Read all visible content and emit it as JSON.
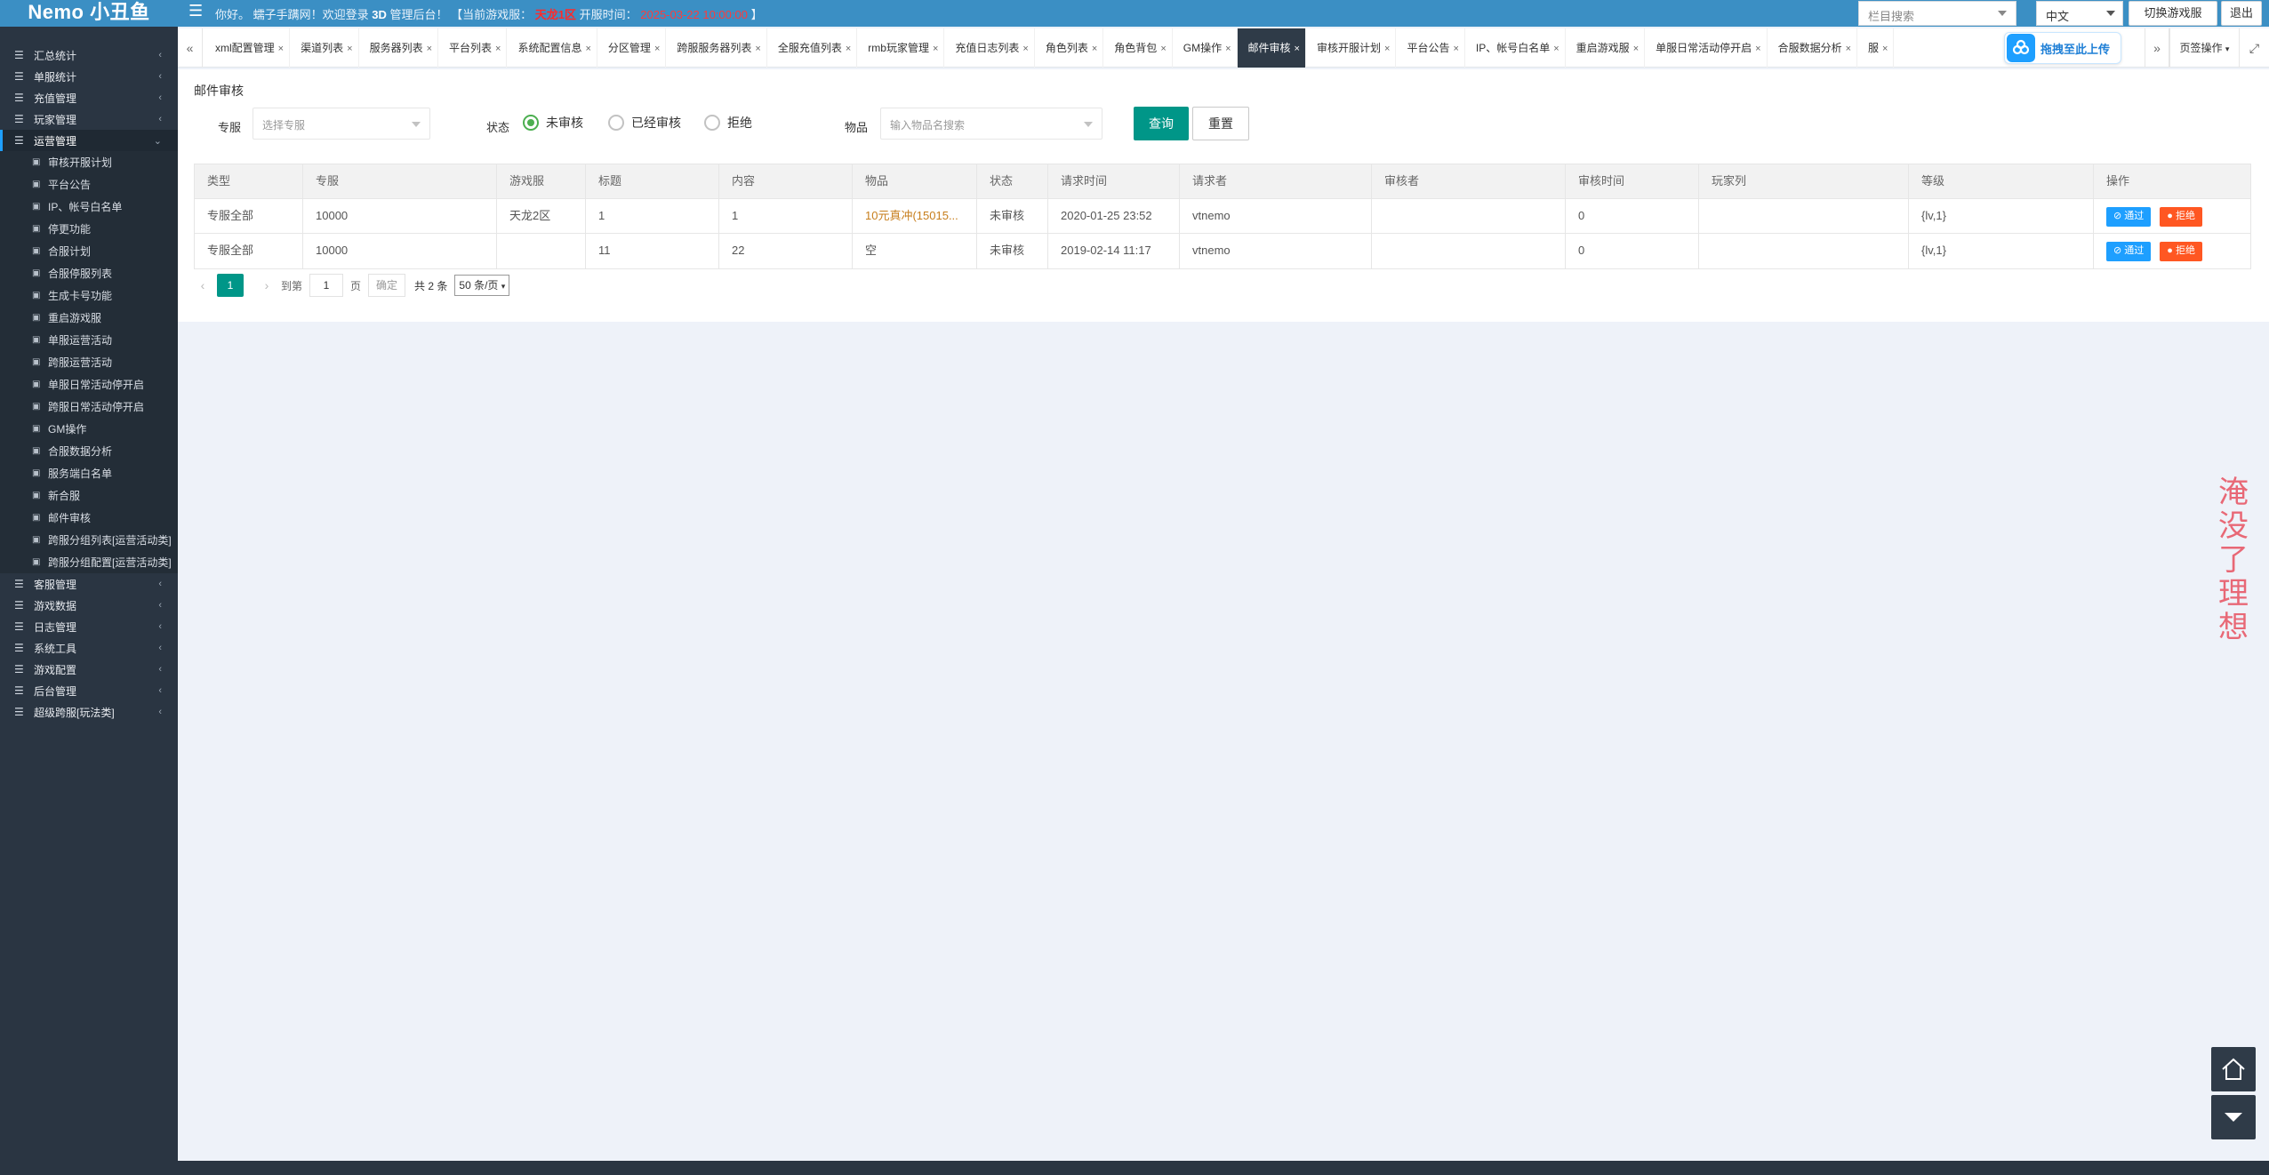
{
  "app": {
    "logo": "Nemo 小丑鱼"
  },
  "header": {
    "welcome_prefix": "你好。 蠕子手蹒网！欢迎登录",
    "welcome_bold": "3D",
    "welcome_mid": "管理后台！ 【当前游戏服：",
    "current_server": "天龙1区",
    "open_time_label": "开服时间：",
    "open_time": "2025-03-22 10:00:00",
    "welcome_suffix": "】",
    "column_search_placeholder": "栏目搜索",
    "language": "中文",
    "switch_server": "切换游戏服",
    "logout": "退出"
  },
  "sidebar": {
    "groups_top": [
      {
        "label": "汇总统计"
      },
      {
        "label": "单服统计"
      },
      {
        "label": "充值管理"
      },
      {
        "label": "玩家管理"
      }
    ],
    "active_group": {
      "label": "运营管理"
    },
    "sub_items": [
      {
        "label": "审核开服计划"
      },
      {
        "label": "平台公告"
      },
      {
        "label": "IP、帐号白名单"
      },
      {
        "label": "停更功能"
      },
      {
        "label": "合服计划"
      },
      {
        "label": "合服停服列表"
      },
      {
        "label": "生成卡号功能"
      },
      {
        "label": "重启游戏服"
      },
      {
        "label": "单服运营活动"
      },
      {
        "label": "跨服运营活动"
      },
      {
        "label": "单服日常活动停开启"
      },
      {
        "label": "跨服日常活动停开启"
      },
      {
        "label": "GM操作"
      },
      {
        "label": "合服数据分析"
      },
      {
        "label": "服务端白名单"
      },
      {
        "label": "新合服"
      },
      {
        "label": "邮件审核"
      },
      {
        "label": "跨服分组列表[运营活动类]"
      },
      {
        "label": "跨服分组配置[运营活动类]"
      }
    ],
    "groups_bottom": [
      {
        "label": "客服管理"
      },
      {
        "label": "游戏数据"
      },
      {
        "label": "日志管理"
      },
      {
        "label": "系统工具"
      },
      {
        "label": "游戏配置"
      },
      {
        "label": "后台管理"
      },
      {
        "label": "超级跨服[玩法类]"
      }
    ]
  },
  "tabs": [
    {
      "label": "xml配置管理",
      "active": false
    },
    {
      "label": "渠道列表",
      "active": false
    },
    {
      "label": "服务器列表",
      "active": false
    },
    {
      "label": "平台列表",
      "active": false
    },
    {
      "label": "系统配置信息",
      "active": false
    },
    {
      "label": "分区管理",
      "active": false
    },
    {
      "label": "跨服服务器列表",
      "active": false
    },
    {
      "label": "全服充值列表",
      "active": false
    },
    {
      "label": "rmb玩家管理",
      "active": false
    },
    {
      "label": "充值日志列表",
      "active": false
    },
    {
      "label": "角色列表",
      "active": false
    },
    {
      "label": "角色背包",
      "active": false
    },
    {
      "label": "GM操作",
      "active": false
    },
    {
      "label": "邮件审核",
      "active": true
    },
    {
      "label": "审核开服计划",
      "active": false
    },
    {
      "label": "平台公告",
      "active": false
    },
    {
      "label": "IP、帐号白名单",
      "active": false
    },
    {
      "label": "重启游戏服",
      "active": false
    },
    {
      "label": "单服日常活动停开启",
      "active": false
    },
    {
      "label": "合服数据分析",
      "active": false
    },
    {
      "label": "服",
      "active": false
    }
  ],
  "tabbar": {
    "close_glyph": "×",
    "upload_label": "拖拽至此上传",
    "page_ops": "页签操作"
  },
  "page": {
    "title": "邮件审核"
  },
  "filters": {
    "server_label": "专服",
    "server_placeholder": "选择专服",
    "status_label": "状态",
    "status_options": [
      "未审核",
      "已经审核",
      "拒绝"
    ],
    "item_label": "物品",
    "item_placeholder": "输入物品名搜索",
    "query_button": "查询",
    "reset_button": "重置"
  },
  "table": {
    "columns": [
      "类型",
      "专服",
      "游戏服",
      "标题",
      "内容",
      "物品",
      "状态",
      "请求时间",
      "请求者",
      "审核者",
      "审核时间",
      "玩家列",
      "等级",
      "操作"
    ],
    "rows": [
      {
        "type": "专服全部",
        "server": "10000",
        "game_server": "天龙2区",
        "title": "1",
        "content": "1",
        "item": "10元真冲(15015...",
        "status": "未审核",
        "request_time": "2020-01-25 23:52",
        "requester": "vtnemo",
        "reviewer": "",
        "review_time": "0",
        "players": "",
        "level": "{lv,1}"
      },
      {
        "type": "专服全部",
        "server": "10000",
        "game_server": "",
        "title": "11",
        "content": "22",
        "item": "空",
        "status": "未审核",
        "request_time": "2019-02-14 11:17",
        "requester": "vtnemo",
        "reviewer": "",
        "review_time": "0",
        "players": "",
        "level": "{lv,1}"
      }
    ],
    "action_pass": "通过",
    "action_reject": "拒绝"
  },
  "pagination": {
    "current_page": "1",
    "goto_label": "到第",
    "goto_value": "1",
    "page_unit": "页",
    "confirm": "确定",
    "total": "共 2 条",
    "page_size": "50 条/页"
  },
  "watermark": "淹没了理想",
  "colors": {
    "header_blue": "#3b8fc4",
    "sidebar_dark": "#2a3542",
    "primary_green": "#009688",
    "pass_blue": "#1e9fff",
    "reject_orange": "#ff5722",
    "server_red": "#ff2a2a"
  }
}
